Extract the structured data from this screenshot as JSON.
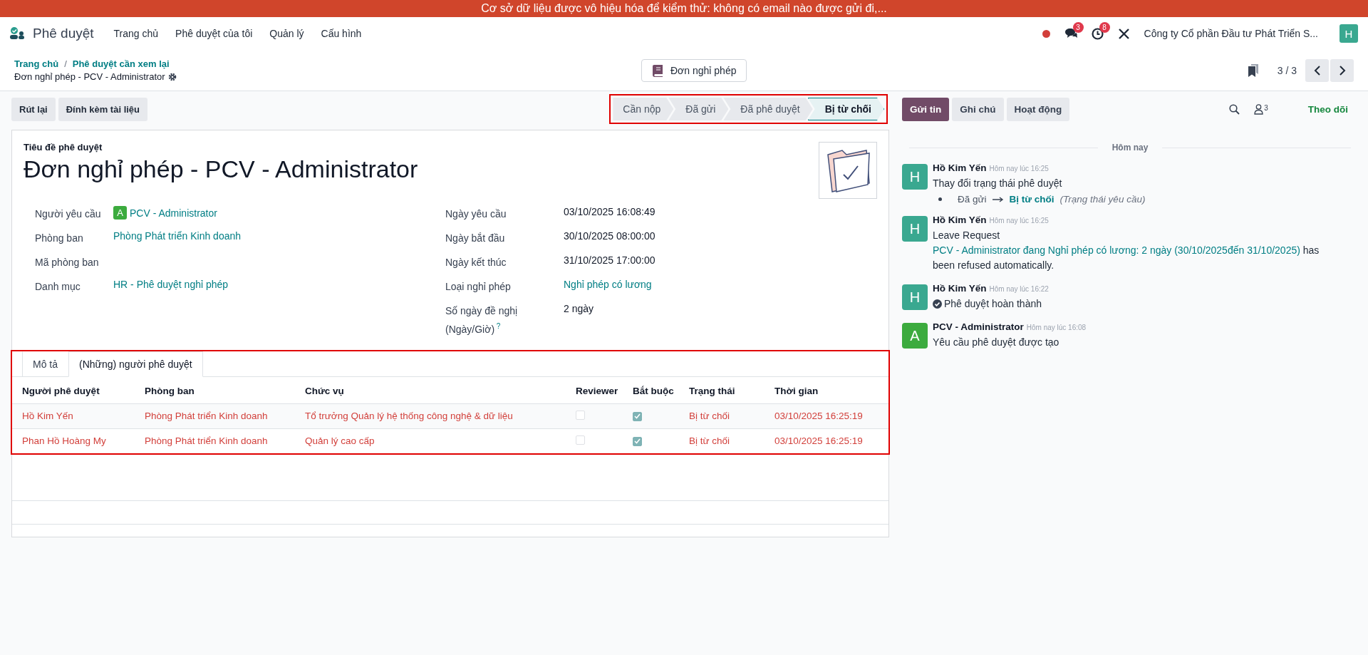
{
  "banner": "Cơ sở dữ liệu được vô hiệu hóa để kiểm thử: không có email nào được gửi đi,...",
  "navbar": {
    "app_name": "Phê duyệt",
    "menus": [
      "Trang chủ",
      "Phê duyệt của tôi",
      "Quản lý",
      "Cấu hình"
    ],
    "messages_badge": "3",
    "activities_badge": "8",
    "company": "Công ty Cổ phần Đầu tư Phát Triển S...",
    "user_avatar": "H"
  },
  "control_panel": {
    "breadcrumbs": [
      "Trang chủ",
      "Phê duyệt cần xem lại"
    ],
    "breadcrumb_separator": "/",
    "record_title": "Đơn nghỉ phép - PCV - Administrator",
    "smart_button": "Đơn nghỉ phép",
    "pager": "3 / 3"
  },
  "actions": [
    "Rút lại",
    "Đính kèm tài liệu"
  ],
  "statusbar": [
    {
      "label": "Cần nộp",
      "selected": false
    },
    {
      "label": "Đã gửi",
      "selected": false
    },
    {
      "label": "Đã phê duyệt",
      "selected": false
    },
    {
      "label": "Bị từ chối",
      "selected": true
    }
  ],
  "form": {
    "title_label": "Tiêu đề phê duyệt",
    "title": "Đơn nghỉ phép - PCV - Administrator",
    "left_fields": [
      {
        "label": "Người yêu cầu",
        "kind": "avatar_link",
        "avatar": "A",
        "value": "PCV - Administrator"
      },
      {
        "label": "Phòng ban",
        "kind": "link",
        "value": "Phòng Phát triển Kinh doanh"
      },
      {
        "label": "Mã phòng ban",
        "kind": "empty"
      },
      {
        "label": "Danh mục",
        "kind": "link",
        "value": "HR - Phê duyệt nghỉ phép"
      }
    ],
    "right_fields": [
      {
        "label": "Ngày yêu cầu",
        "kind": "text",
        "value": "03/10/2025 16:08:49"
      },
      {
        "label": "Ngày bắt đầu",
        "kind": "text",
        "value": "30/10/2025 08:00:00"
      },
      {
        "label": "Ngày kết thúc",
        "kind": "text",
        "value": "31/10/2025 17:00:00"
      },
      {
        "label": "Loại nghỉ phép",
        "kind": "link",
        "value": "Nghỉ phép có lương"
      },
      {
        "label": "Số ngày đề nghị (Ngày/Giờ)",
        "kind": "text",
        "help": "?",
        "value": "2 ngày"
      }
    ],
    "tabs": [
      {
        "label": "Mô tả",
        "selected": false
      },
      {
        "label": "(Những) người phê duyệt",
        "selected": true
      }
    ],
    "table": {
      "columns": [
        "Người phê duyệt",
        "Phòng ban",
        "Chức vụ",
        "Reviewer",
        "Bắt buộc",
        "Trạng thái",
        "Thời gian"
      ],
      "rows": [
        {
          "approver": "Hồ Kim Yến",
          "department": "Phòng Phát triển Kinh doanh",
          "position": "Tổ trưởng Quản lý hệ thống công nghệ & dữ liệu",
          "reviewer": false,
          "required": true,
          "status": "Bị từ chối",
          "time": "03/10/2025 16:25:19",
          "refused": true
        },
        {
          "approver": "Phan Hồ Hoàng My",
          "department": "Phòng Phát triển Kinh doanh",
          "position": "Quản lý cao cấp",
          "reviewer": false,
          "required": true,
          "status": "Bị từ chối",
          "time": "03/10/2025 16:25:19",
          "refused": true
        }
      ]
    }
  },
  "chatter": {
    "buttons": [
      {
        "label": "Gửi tin",
        "selected": true
      },
      {
        "label": "Ghi chú",
        "selected": false
      },
      {
        "label": "Hoạt động",
        "selected": false
      }
    ],
    "followers_count": "3",
    "follow": "Theo dõi",
    "date_separator": "Hôm nay",
    "messages": [
      {
        "author": "Hồ Kim Yến",
        "avatar": "H",
        "color": "#3aa890",
        "time": "Hôm nay lúc 16:25",
        "kind": "tracking",
        "body": "Thay đổi trạng thái phê duyệt",
        "old": "Đã gửi",
        "new": "Bị từ chối",
        "field": "(Trạng thái yêu cầu)"
      },
      {
        "author": "Hồ Kim Yến",
        "avatar": "H",
        "color": "#3aa890",
        "time": "Hôm nay lúc 16:25",
        "kind": "link",
        "before": "Leave Request",
        "link": "PCV - Administrator đang Nghỉ phép có lương: 2 ngày (30/10/2025đến 31/10/2025)",
        "after": "has been refused automatically."
      },
      {
        "author": "Hồ Kim Yến",
        "avatar": "H",
        "color": "#3aa890",
        "time": "Hôm nay lúc 16:22",
        "kind": "check",
        "body": "Phê duyệt hoàn thành"
      },
      {
        "author": "PCV - Administrator",
        "avatar": "A",
        "color": "#3cab3e",
        "time": "Hôm nay lúc 16:08",
        "kind": "plain",
        "body": "Yêu cầu phê duyệt được tạo"
      }
    ]
  }
}
